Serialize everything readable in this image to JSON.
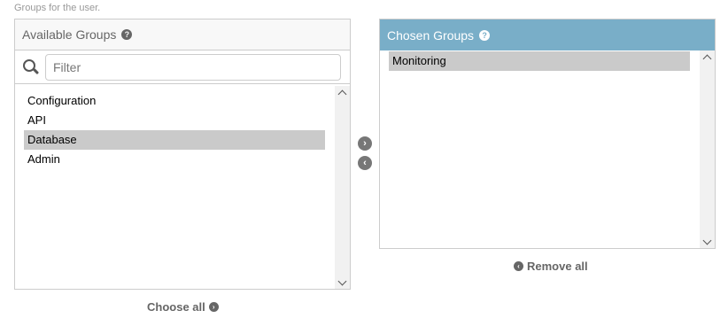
{
  "help_text": "Groups for the user.",
  "available": {
    "title": "Available Groups",
    "help_icon": "?",
    "filter_placeholder": "Filter",
    "filter_value": "",
    "options": [
      "Configuration",
      "API",
      "Database",
      "Admin"
    ],
    "selected_option": "Database"
  },
  "chosen": {
    "title": "Chosen Groups",
    "help_icon": "?",
    "options": [
      "Monitoring"
    ],
    "selected_option": "Monitoring"
  },
  "actions": {
    "add_icon": "arrow-right-circle-icon",
    "remove_icon": "arrow-left-circle-icon",
    "choose_all": "Choose all",
    "remove_all": "Remove all"
  },
  "colors": {
    "chosen_header": "#79aec8",
    "selected_option": "#cacaca"
  }
}
